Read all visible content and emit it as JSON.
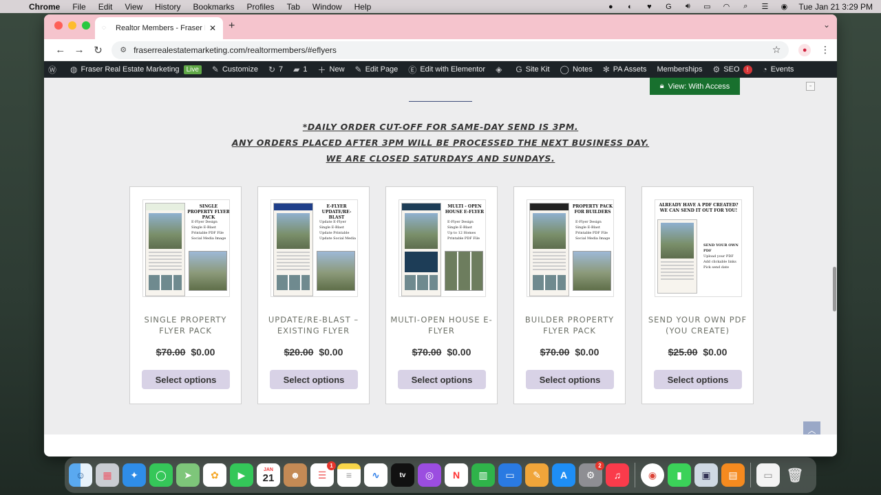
{
  "menubar": {
    "app": "Chrome",
    "items": [
      "File",
      "Edit",
      "View",
      "History",
      "Bookmarks",
      "Profiles",
      "Tab",
      "Window",
      "Help"
    ],
    "clock": "Tue Jan 21  3:29 PM"
  },
  "browser": {
    "tab_title": "Realtor Members - Fraser Re",
    "url": "fraserrealestatemarketing.com/realtormembers/#eflyers"
  },
  "wpbar": {
    "site_name": "Fraser Real Estate Marketing",
    "live": "Live",
    "customize": "Customize",
    "updates": "7",
    "comments": "1",
    "new": "New",
    "edit_page": "Edit Page",
    "elementor": "Edit with Elementor",
    "site_kit": "Site Kit",
    "notes": "Notes",
    "pa_assets": "PA Assets",
    "memberships": "Memberships",
    "seo": "SEO",
    "seo_badge": "!",
    "events": "Events"
  },
  "page": {
    "access_button": "View: With Access",
    "notice_lines": [
      "*DAILY ORDER CUT-OFF FOR SAME-DAY SEND IS 3PM.",
      "ANY ORDERS PLACED AFTER 3PM WILL BE PROCESSED THE NEXT BUSINESS DAY.",
      "WE ARE CLOSED SATURDAYS AND SUNDAYS."
    ],
    "products": [
      {
        "title": "SINGLE PROPERTY FLYER PACK",
        "old_price": "$70.00",
        "price": "$0.00",
        "button": "Select options",
        "thumb_title": "SINGLE PROPERTY FLYER PACK",
        "thumb_bullets": [
          "E-Flyer Design",
          "Single E-Blast",
          "Printable PDF File",
          "Social Media Image"
        ]
      },
      {
        "title": "UPDATE/RE-BLAST – EXISTING FLYER",
        "old_price": "$20.00",
        "price": "$0.00",
        "button": "Select options",
        "thumb_title": "E-FLYER UPDATE/RE-BLAST",
        "thumb_bullets": [
          "Update E-Flyer",
          "Single E-Blast",
          "Update Printable",
          "Update Social Media"
        ]
      },
      {
        "title": "MULTI-OPEN HOUSE E-FLYER",
        "old_price": "$70.00",
        "price": "$0.00",
        "button": "Select options",
        "thumb_title": "MULTI - OPEN HOUSE E-FLYER",
        "thumb_bullets": [
          "E-Flyer Design",
          "Single E-Blast",
          "Up to 12 Homes",
          "Printable PDF File"
        ]
      },
      {
        "title": "BUILDER PROPERTY FLYER PACK",
        "old_price": "$70.00",
        "price": "$0.00",
        "button": "Select options",
        "thumb_title": "PROPERTY PACK FOR BUILDERS",
        "thumb_bullets": [
          "E-Flyer Design",
          "Single E-Blast",
          "Printable PDF File",
          "Social Media Image"
        ]
      },
      {
        "title": "SEND YOUR OWN PDF (YOU CREATE)",
        "old_price": "$25.00",
        "price": "$0.00",
        "button": "Select options",
        "thumb_title": "ALREADY HAVE A PDF CREATED? WE CAN SEND IT OUT FOR YOU!",
        "thumb_bullets": [
          "SEND YOUR OWN PDF",
          "Upload your PDF",
          "Add clickable links",
          "Pick send date"
        ]
      }
    ]
  },
  "dock": {
    "calendar_month": "JAN",
    "calendar_day": "21",
    "reminders_badge": "1",
    "settings_badge": "2"
  }
}
